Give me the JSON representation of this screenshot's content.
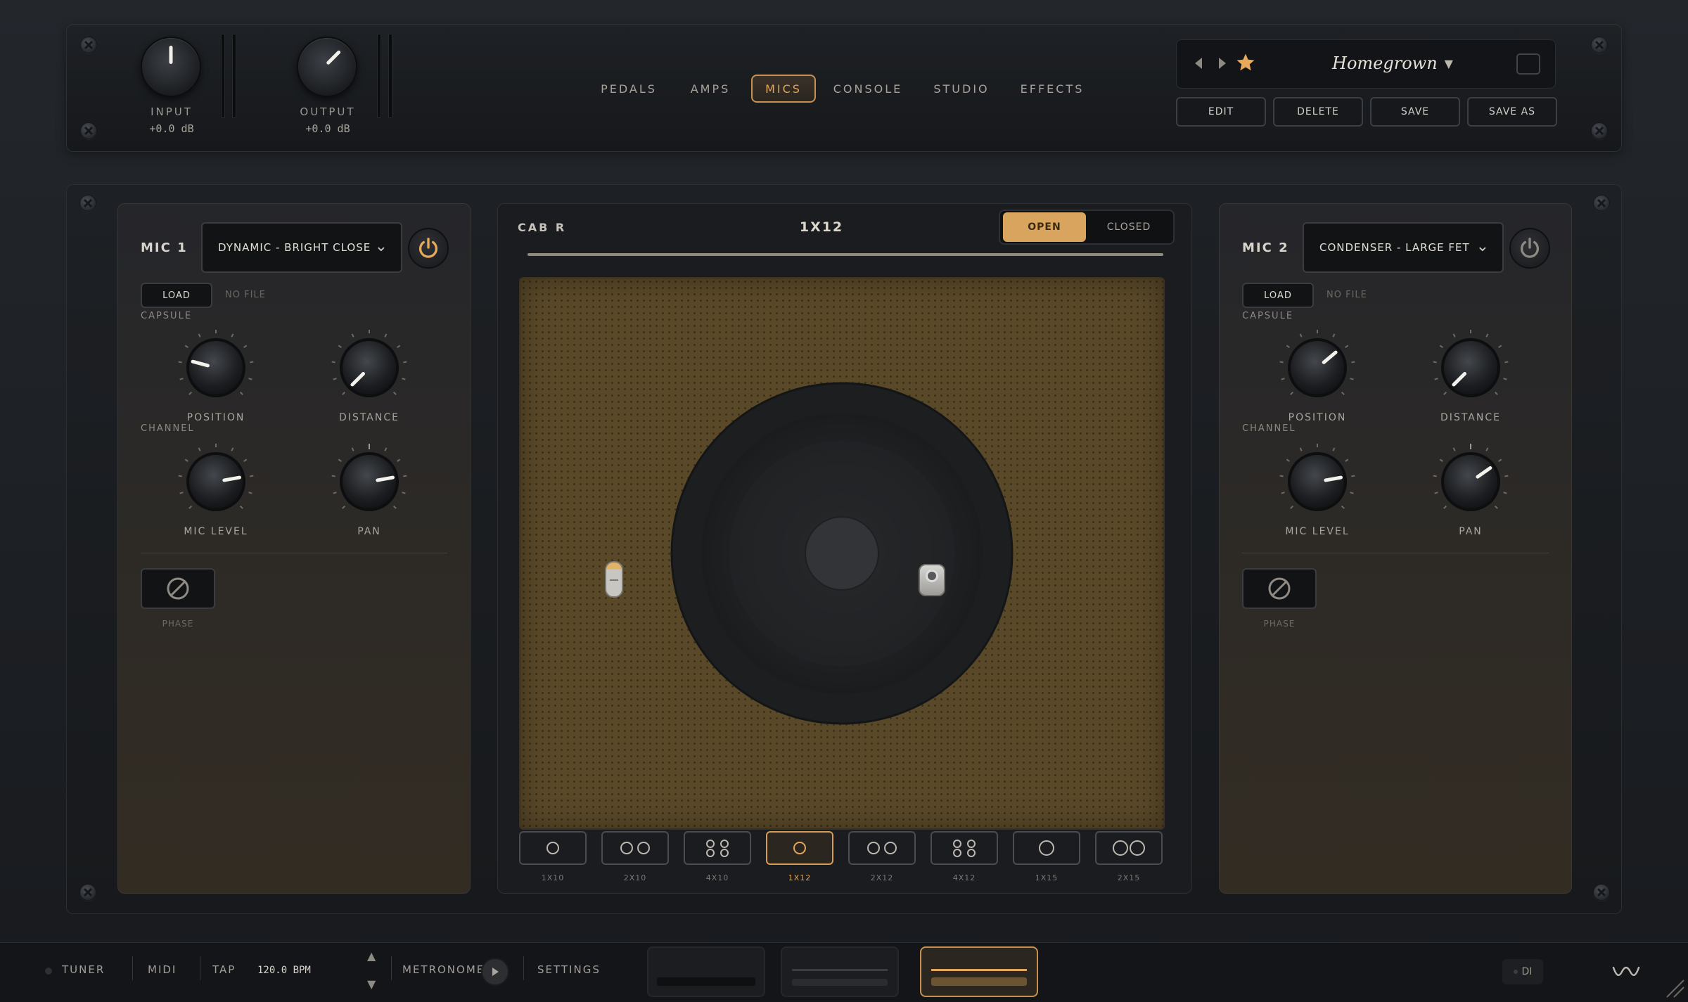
{
  "header": {
    "input": {
      "label": "INPUT",
      "value": "+0.0 dB"
    },
    "output": {
      "label": "OUTPUT",
      "value": "+0.0 dB"
    },
    "tabs": [
      {
        "label": "PEDALS"
      },
      {
        "label": "AMPS"
      },
      {
        "label": "MICS",
        "active": true
      },
      {
        "label": "CONSOLE"
      },
      {
        "label": "STUDIO"
      },
      {
        "label": "EFFECTS"
      }
    ],
    "preset": {
      "name": "Homegrown",
      "buttons": {
        "edit": "EDIT",
        "delete": "DELETE",
        "save": "SAVE",
        "save_as": "SAVE AS"
      }
    }
  },
  "mic1": {
    "title": "MIC 1",
    "model": "DYNAMIC - BRIGHT CLOSE",
    "power_on": true,
    "load_label": "LOAD",
    "file_label": "NO FILE",
    "capsule_label": "CAPSULE",
    "channel_label": "CHANNEL",
    "knobs": {
      "position": "POSITION",
      "distance": "DISTANCE",
      "mic_level": "MIC LEVEL",
      "pan": "PAN"
    },
    "phase_label": "PHASE"
  },
  "mic2": {
    "title": "MIC 2",
    "model": "CONDENSER - LARGE FET",
    "power_on": false,
    "load_label": "LOAD",
    "file_label": "NO FILE",
    "capsule_label": "CAPSULE",
    "channel_label": "CHANNEL",
    "knobs": {
      "position": "POSITION",
      "distance": "DISTANCE",
      "mic_level": "MIC LEVEL",
      "pan": "PAN"
    },
    "phase_label": "PHASE"
  },
  "cab": {
    "label": "CAB",
    "side": "R",
    "current": "1X12",
    "back_open": "OPEN",
    "back_closed": "CLOSED",
    "types": [
      {
        "label": "1X10"
      },
      {
        "label": "2X10"
      },
      {
        "label": "4X10"
      },
      {
        "label": "1X12",
        "active": true
      },
      {
        "label": "2X12"
      },
      {
        "label": "4X12"
      },
      {
        "label": "1X15"
      },
      {
        "label": "2X15"
      }
    ]
  },
  "footer": {
    "tuner": "TUNER",
    "midi": "MIDI",
    "tap": "TAP",
    "bpm": "120.0 BPM",
    "metronome": "METRONOME",
    "settings": "SETTINGS",
    "di": "DI"
  },
  "colors": {
    "accent": "#e2a65a",
    "grill": "#5a4929"
  }
}
